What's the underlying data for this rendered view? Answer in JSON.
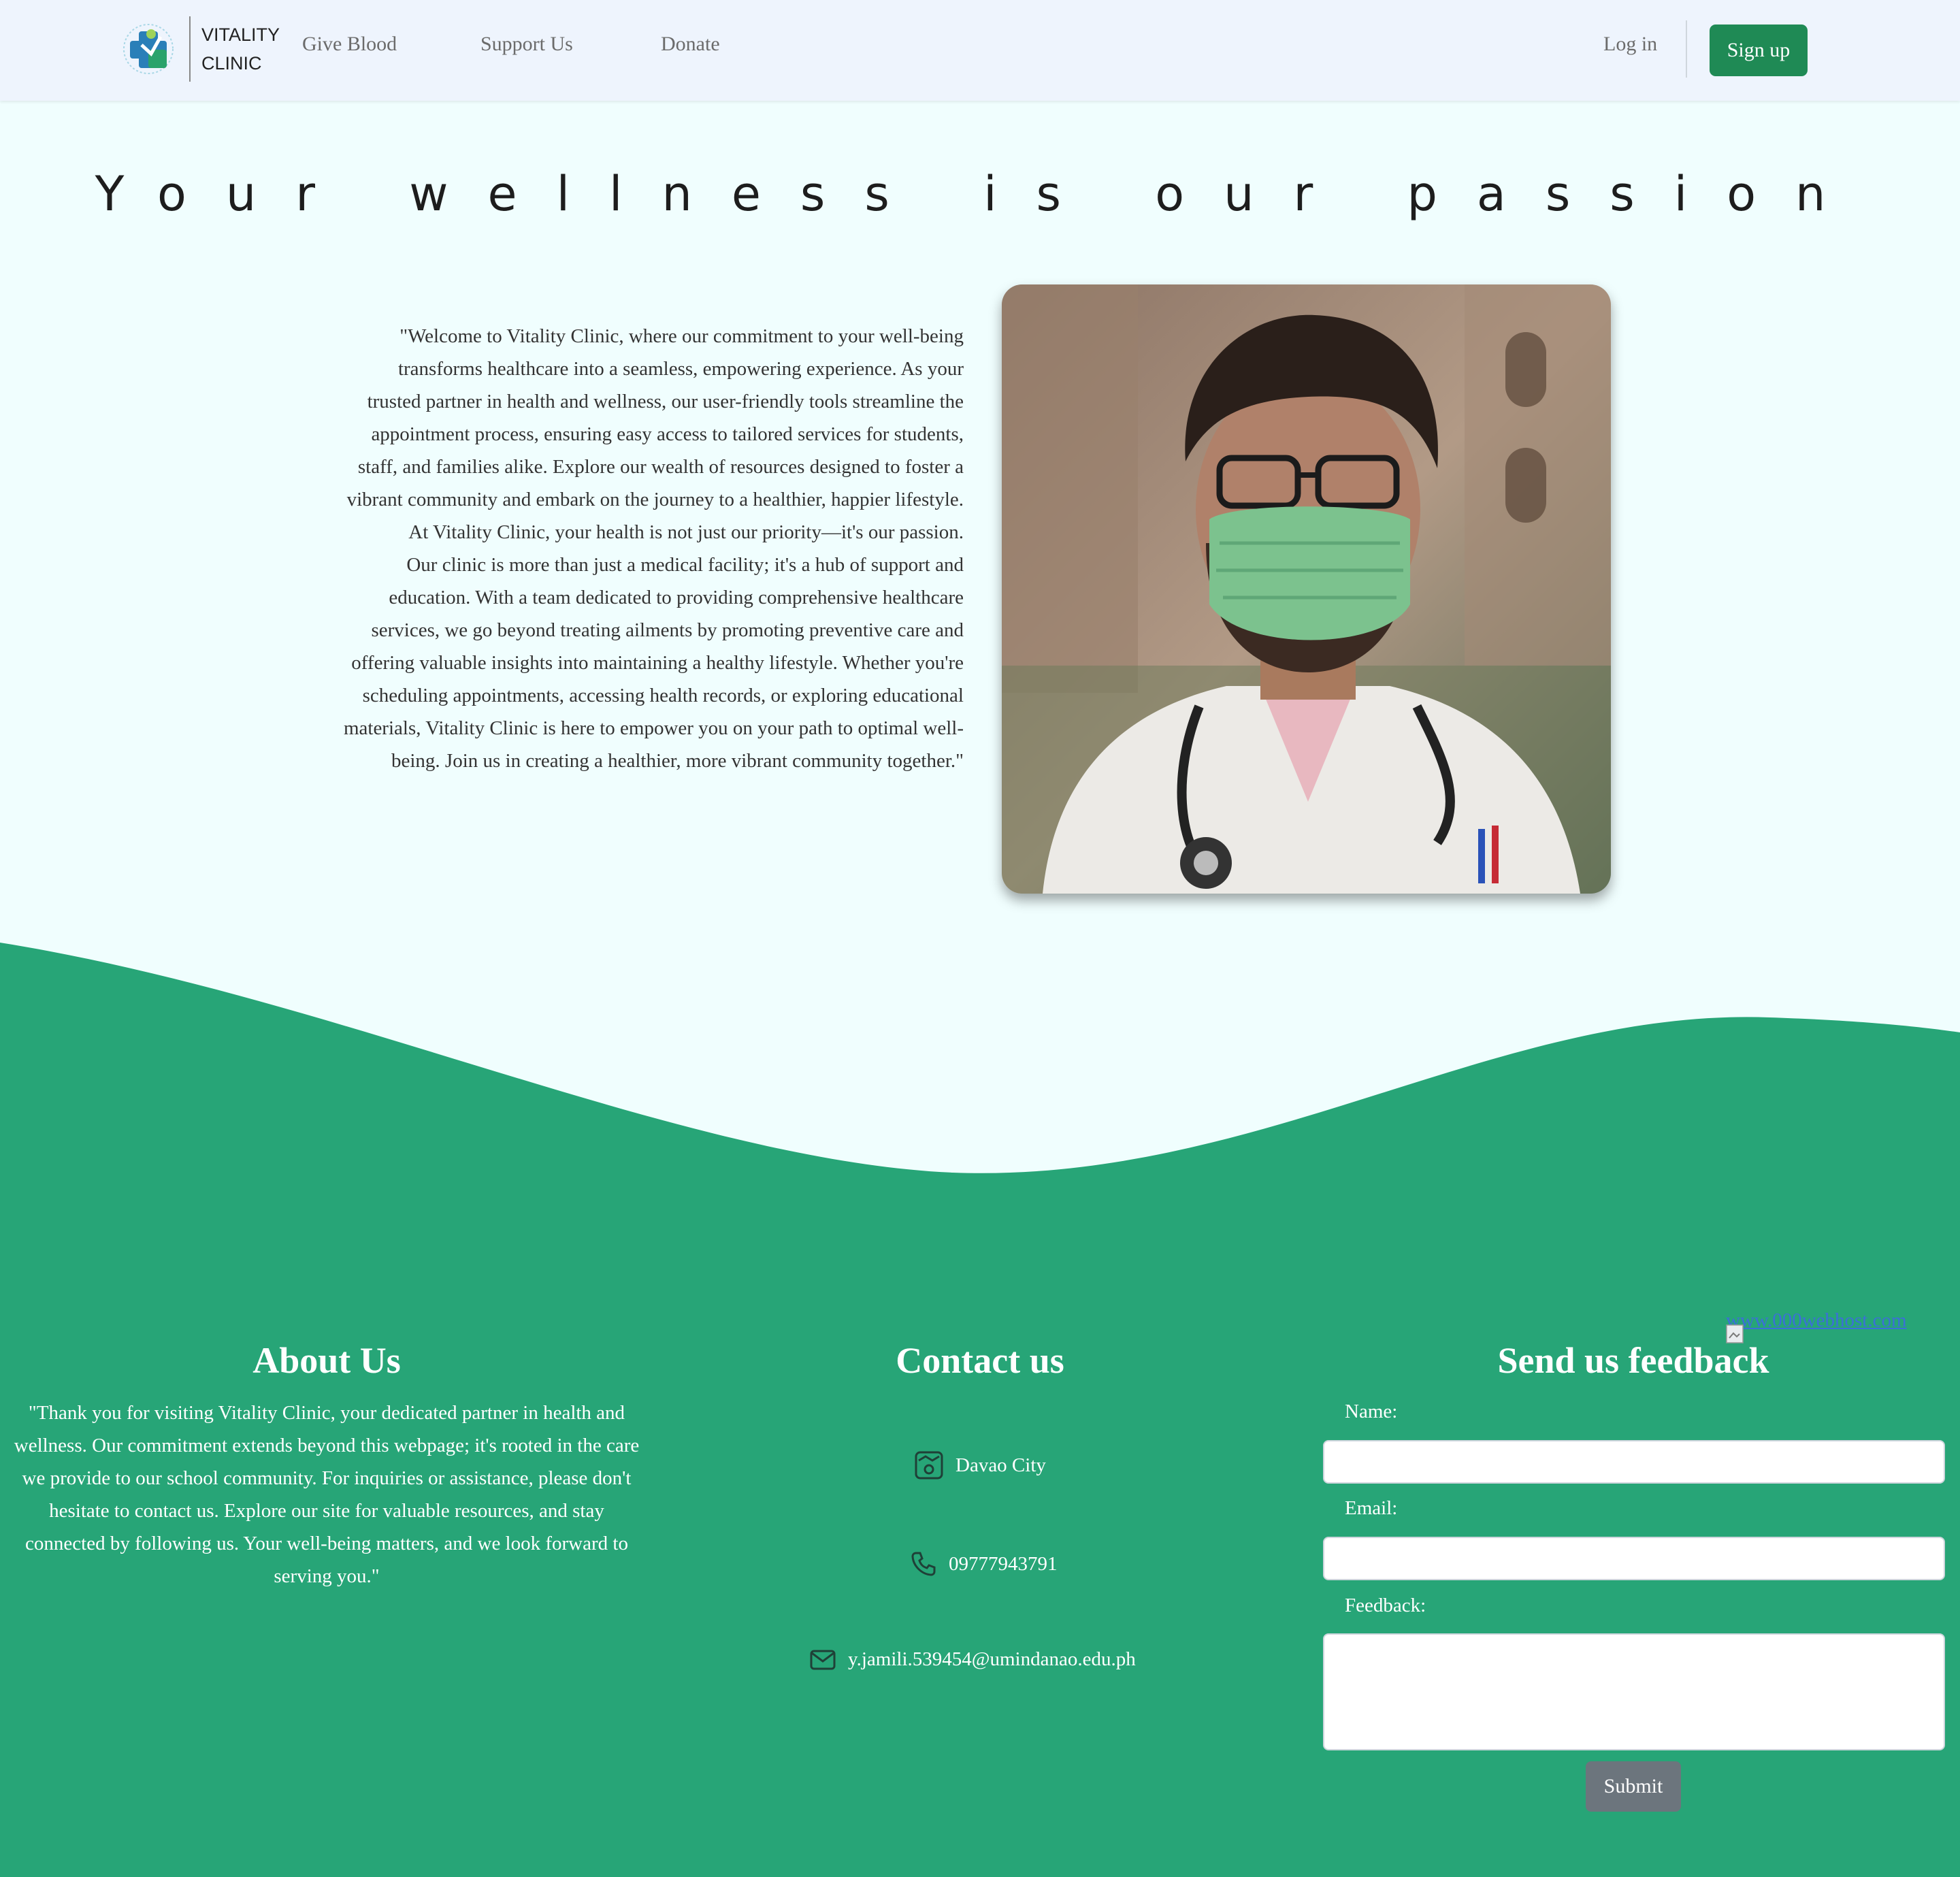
{
  "brand": {
    "line1": "VITALITY",
    "line2": "CLINIC",
    "logo_text": "VITALITY CLINIC"
  },
  "nav": {
    "links": [
      {
        "label": "Give Blood"
      },
      {
        "label": "Support Us"
      },
      {
        "label": "Donate"
      }
    ],
    "login": "Log in",
    "signup": "Sign up"
  },
  "hero": {
    "title": "Your wellness is our passion",
    "paragraph1": "\"Welcome to Vitality Clinic, where our commitment to your well-being transforms healthcare into a seamless, empowering experience. As your trusted partner in health and wellness, our user-friendly tools streamline the appointment process, ensuring easy access to tailored services for students, staff, and families alike. Explore our wealth of resources designed to foster a vibrant community and embark on the journey to a healthier, happier lifestyle. At Vitality Clinic, your health is not just our priority—it's our passion.",
    "paragraph2": "Our clinic is more than just a medical facility; it's a hub of support and education. With a team dedicated to providing comprehensive healthcare services, we go beyond treating ailments by promoting preventive care and offering valuable insights into maintaining a healthy lifestyle. Whether you're scheduling appointments, accessing health records, or exploring educational materials, Vitality Clinic is here to empower you on your path to optimal well-being. Join us in creating a healthier, more vibrant community together.\""
  },
  "footer": {
    "about": {
      "title": "About Us",
      "text": "\"Thank you for visiting Vitality Clinic, your dedicated partner in health and wellness. Our commitment extends beyond this webpage; it's rooted in the care we provide to our school community. For inquiries or assistance, please don't hesitate to contact us. Explore our site for valuable resources, and stay connected by following us. Your well-being matters, and we look forward to serving you.\""
    },
    "contact": {
      "title": "Contact us",
      "location": "Davao City",
      "phone": "09777943791",
      "email": "y.jamili.539454@umindanao.edu.ph"
    },
    "feedback": {
      "title": "Send us feedback",
      "name_label": "Name:",
      "email_label": "Email:",
      "feedback_label": "Feedback:",
      "name_value": "",
      "email_value": "",
      "feedback_value": "",
      "submit": "Submit"
    },
    "host_link": "www.000webhost.com"
  },
  "colors": {
    "primary_green": "#27a577",
    "signup_green": "#1f8a55",
    "nav_bg": "#eef4fd",
    "page_bg": "#f0fefe",
    "submit_gray": "#6c757d"
  },
  "icons": [
    "logo-icon",
    "map-icon",
    "phone-icon",
    "mail-icon"
  ]
}
